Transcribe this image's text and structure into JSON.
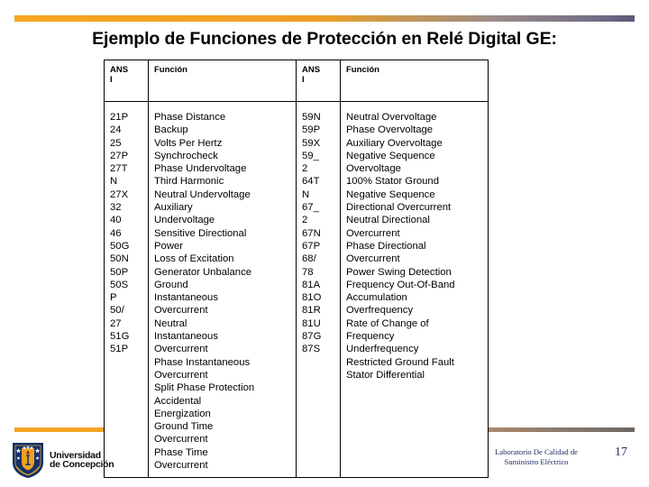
{
  "slide": {
    "title": "Ejemplo de Funciones de Protección en Relé Digital GE:",
    "page_number": "17",
    "accent_orange": "#F5A623",
    "accent_slate": "#6F6B86",
    "footer_navy": "#1F2A63"
  },
  "logo": {
    "line1": "Universidad",
    "line2": "de Concepción"
  },
  "lab": {
    "line1": "Laboratorio De Calidad de",
    "line2": "Suministro Eléctrico"
  },
  "table": {
    "headers": {
      "ansi_line1": "ANS",
      "ansi_line2": "I",
      "funcion": "Función"
    },
    "left_codes": [
      "21P",
      "24",
      "25",
      "27P",
      "27T",
      "N",
      "27X",
      "32",
      "40",
      "46",
      "50G",
      "50N",
      "50P",
      "50S",
      "P",
      "50/",
      "27",
      "51G",
      "51P"
    ],
    "left_functions": [
      "Phase Distance",
      "Backup",
      "Volts Per Hertz",
      "Synchrocheck",
      "Phase Undervoltage",
      "Third Harmonic",
      "Neutral Undervoltage",
      "Auxiliary",
      "Undervoltage",
      "Sensitive Directional",
      "Power",
      "Loss of Excitation",
      "Generator Unbalance",
      "Ground",
      "Instantaneous",
      "Overcurrent",
      "Neutral",
      "Instantaneous",
      "Overcurrent",
      "Phase Instantaneous",
      "Overcurrent",
      "Split Phase Protection",
      "Accidental",
      "Energization",
      "Ground Time",
      "Overcurrent",
      "Phase Time",
      "Overcurrent"
    ],
    "right_codes": [
      "59N",
      "59P",
      "59X",
      "59_",
      "2",
      "64T",
      "N",
      "67_",
      "2",
      "67N",
      "67P",
      "68/",
      "78",
      "81A",
      "81O",
      "81R",
      "81U",
      "87G",
      "87S"
    ],
    "right_functions": [
      "Neutral Overvoltage",
      "Phase Overvoltage",
      "Auxiliary Overvoltage",
      "Negative Sequence",
      "Overvoltage",
      "100% Stator Ground",
      "Negative Sequence",
      "Directional Overcurrent",
      "Neutral Directional",
      "Overcurrent",
      "Phase Directional",
      "Overcurrent",
      "Power Swing Detection",
      "Frequency Out-Of-Band",
      "Accumulation",
      "Overfrequency",
      "Rate of Change of",
      "Frequency",
      "Underfrequency",
      "Restricted Ground Fault",
      "Stator Differential"
    ]
  }
}
